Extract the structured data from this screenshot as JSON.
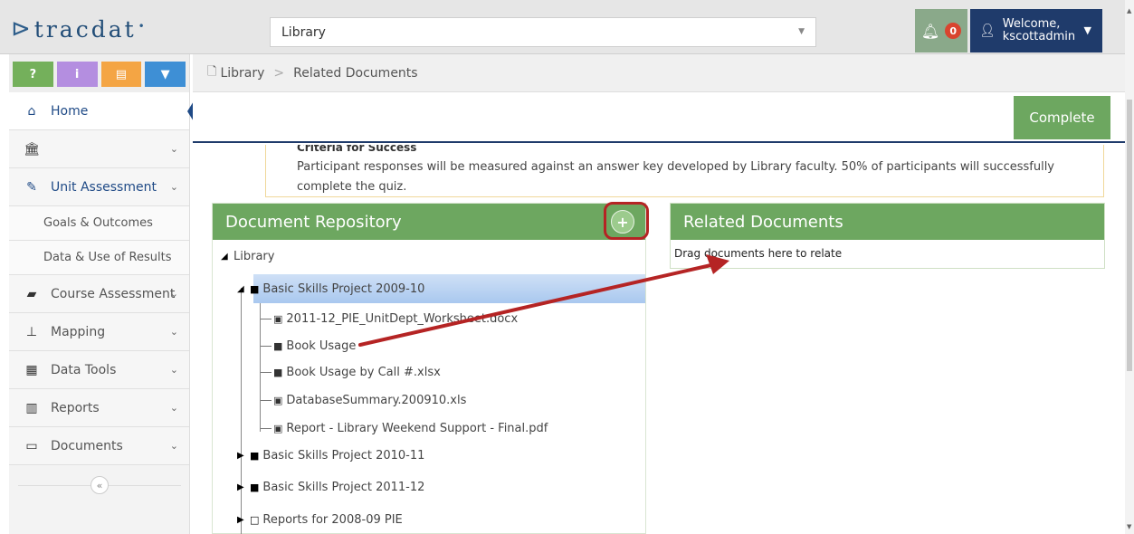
{
  "header": {
    "logo_text": "tracdat",
    "context_select_value": "Library",
    "notification_count": "0",
    "user_welcome": "Welcome,",
    "user_name": "kscottadmin"
  },
  "quick_tools": [
    {
      "label": "?",
      "icon": "help-icon",
      "color": "#74b05b"
    },
    {
      "label": "i",
      "icon": "info-icon",
      "color": "#b48ee0"
    },
    {
      "label": "▤",
      "icon": "calendar-icon",
      "color": "#f4a544"
    },
    {
      "label": "▼",
      "icon": "filter-icon",
      "color": "#3e8fd5"
    }
  ],
  "sidebar": {
    "home_label": "Home",
    "institution_label": "",
    "unit_assessment_label": "Unit Assessment",
    "sub_items": [
      "Goals & Outcomes",
      "Data & Use of Results"
    ],
    "course_assessment_label": "Course Assessment",
    "mapping_label": "Mapping",
    "data_tools_label": "Data Tools",
    "reports_label": "Reports",
    "documents_label": "Documents",
    "collapse_label": "«"
  },
  "breadcrumb": {
    "root": "Library",
    "separator": ">",
    "current": "Related Documents"
  },
  "actions": {
    "complete_label": "Complete"
  },
  "criteria": {
    "title": "Criteria for Success",
    "text": "Participant responses will be measured against an answer key developed by Library faculty. 50% of participants will successfully complete the quiz."
  },
  "repository": {
    "title": "Document Repository",
    "add_label": "+",
    "root": "Library",
    "selected_folder": "Basic Skills Project 2009-10",
    "files": [
      "2011-12_PIE_UnitDept_Worksheet.docx",
      "Book Usage",
      "Book Usage by Call #.xlsx",
      "DatabaseSummary.200910.xls",
      "Report - Library Weekend Support - Final.pdf"
    ],
    "folders": [
      "Basic Skills Project 2010-11",
      "Basic Skills Project 2011-12",
      "Reports for 2008-09 PIE"
    ]
  },
  "related": {
    "title": "Related Documents",
    "drop_hint": "Drag documents here to relate"
  },
  "colors": {
    "panel_green": "#6da760",
    "nav_blue": "#1f3b6b",
    "annotation_red": "#b52424"
  }
}
